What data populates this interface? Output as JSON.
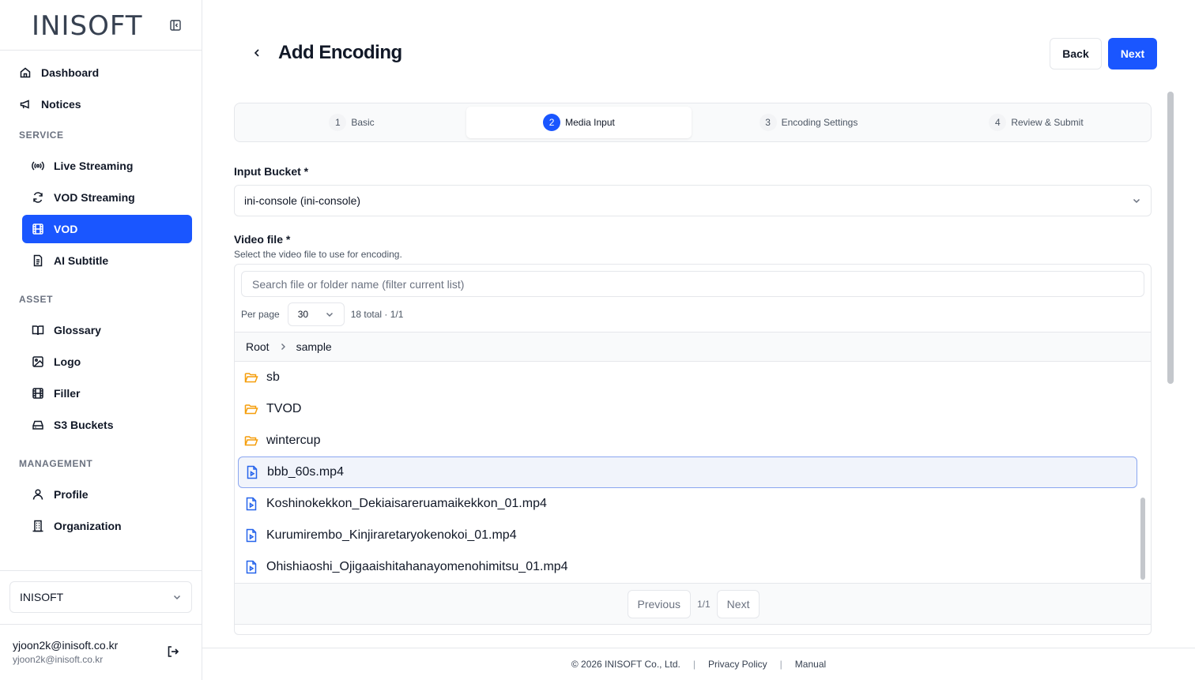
{
  "brand": {
    "logo_text": "INISOFT"
  },
  "sidebar": {
    "top_items": [
      {
        "label": "Dashboard",
        "icon": "home-icon"
      },
      {
        "label": "Notices",
        "icon": "megaphone-icon"
      }
    ],
    "sections": {
      "service": {
        "label": "SERVICE",
        "items": [
          {
            "label": "Live Streaming",
            "icon": "broadcast-icon"
          },
          {
            "label": "VOD Streaming",
            "icon": "refresh-icon"
          },
          {
            "label": "VOD",
            "icon": "film-icon",
            "active": true
          },
          {
            "label": "AI Subtitle",
            "icon": "document-icon"
          }
        ]
      },
      "asset": {
        "label": "ASSET",
        "items": [
          {
            "label": "Glossary",
            "icon": "book-icon"
          },
          {
            "label": "Logo",
            "icon": "image-icon"
          },
          {
            "label": "Filler",
            "icon": "film-icon"
          },
          {
            "label": "S3 Buckets",
            "icon": "drive-icon"
          }
        ]
      },
      "management": {
        "label": "MANAGEMENT",
        "items": [
          {
            "label": "Profile",
            "icon": "user-icon"
          },
          {
            "label": "Organization",
            "icon": "building-icon"
          }
        ]
      }
    },
    "organization": {
      "selected": "INISOFT"
    },
    "user": {
      "name": "yjoon2k@inisoft.co.kr",
      "email": "yjoon2k@inisoft.co.kr"
    }
  },
  "header": {
    "title": "Add Encoding",
    "back_label": "Back",
    "next_label": "Next"
  },
  "steps": [
    {
      "num": "1",
      "label": "Basic"
    },
    {
      "num": "2",
      "label": "Media Input",
      "active": true
    },
    {
      "num": "3",
      "label": "Encoding Settings"
    },
    {
      "num": "4",
      "label": "Review & Submit"
    }
  ],
  "form": {
    "bucket_label": "Input Bucket *",
    "bucket_value": "ini-console (ini-console)",
    "video_label": "Video file *",
    "video_hint": "Select the video file to use for encoding."
  },
  "browser": {
    "search_placeholder": "Search file or folder name (filter current list)",
    "per_page_label": "Per page",
    "per_page_value": "30",
    "total_text": "18 total · 1/1",
    "breadcrumb": [
      "Root",
      "sample"
    ],
    "files": [
      {
        "name": "sb",
        "type": "folder"
      },
      {
        "name": "TVOD",
        "type": "folder"
      },
      {
        "name": "wintercup",
        "type": "folder"
      },
      {
        "name": "bbb_60s.mp4",
        "type": "video",
        "selected": true
      },
      {
        "name": "Koshinokekkon_Dekiaisareruamaikekkon_01.mp4",
        "type": "video"
      },
      {
        "name": "Kurumirembo_Kinjiraretaryokenokoi_01.mp4",
        "type": "video"
      },
      {
        "name": "Ohishiaoshi_Ojigaaishitahanayomenohimitsu_01.mp4",
        "type": "video"
      }
    ],
    "pager": {
      "prev": "Previous",
      "info": "1/1",
      "next": "Next"
    }
  },
  "footer": {
    "copyright": "© 2026 INISOFT Co., Ltd.",
    "privacy": "Privacy Policy",
    "manual": "Manual"
  },
  "colors": {
    "accent": "#1a56ff",
    "folder": "#f59e0b",
    "video": "#2563eb"
  }
}
